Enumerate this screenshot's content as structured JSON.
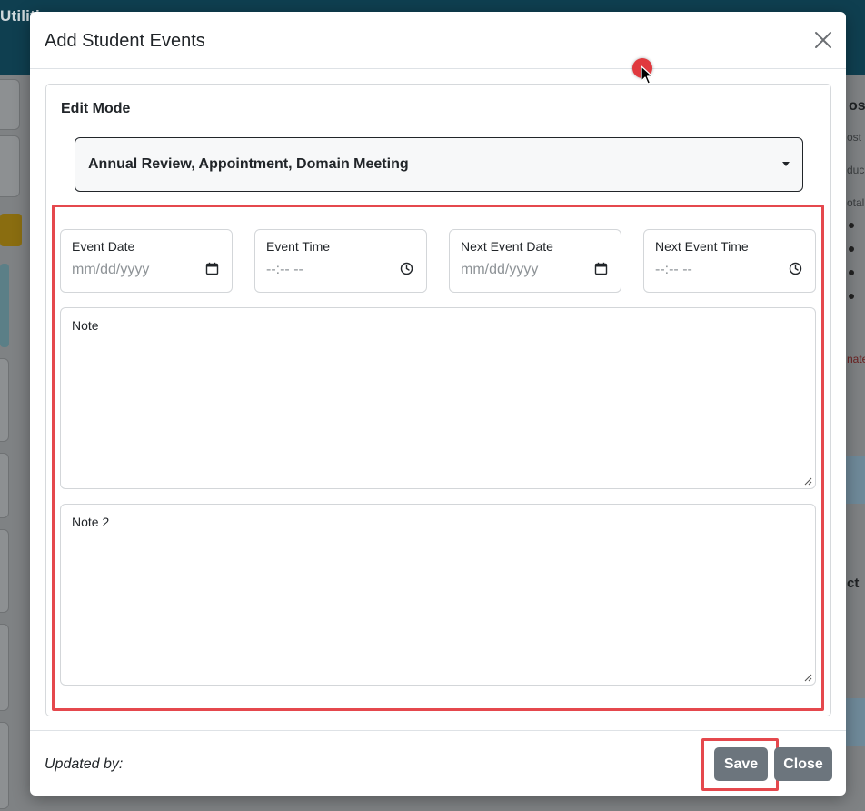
{
  "background": {
    "app_title_fragment": "Utiliti",
    "right_heading_fragment": "os",
    "right_lines": [
      "ost",
      "duca",
      "otal"
    ],
    "right_red_fragment": "nate",
    "right_bold_fragment": "ct"
  },
  "modal": {
    "title": "Add Student Events",
    "close_icon": "close-icon",
    "edit_mode_label": "Edit Mode",
    "event_type_select": {
      "value": "Annual Review, Appointment, Domain Meeting"
    },
    "fields": [
      {
        "label": "Event Date",
        "placeholder": "mm/dd/yyyy",
        "icon": "calendar-icon"
      },
      {
        "label": "Event Time",
        "placeholder": "--:-- --",
        "icon": "clock-icon"
      },
      {
        "label": "Next Event Date",
        "placeholder": "mm/dd/yyyy",
        "icon": "calendar-icon"
      },
      {
        "label": "Next Event Time",
        "placeholder": "--:-- --",
        "icon": "clock-icon"
      }
    ],
    "notes": [
      {
        "label": "Note"
      },
      {
        "label": "Note 2"
      }
    ],
    "footer": {
      "updated_by_label": "Updated by:",
      "save_label": "Save",
      "close_label": "Close"
    }
  },
  "colors": {
    "highlight": "#e5484d",
    "button": "#6c757d",
    "topbar": "#0f3f50"
  }
}
